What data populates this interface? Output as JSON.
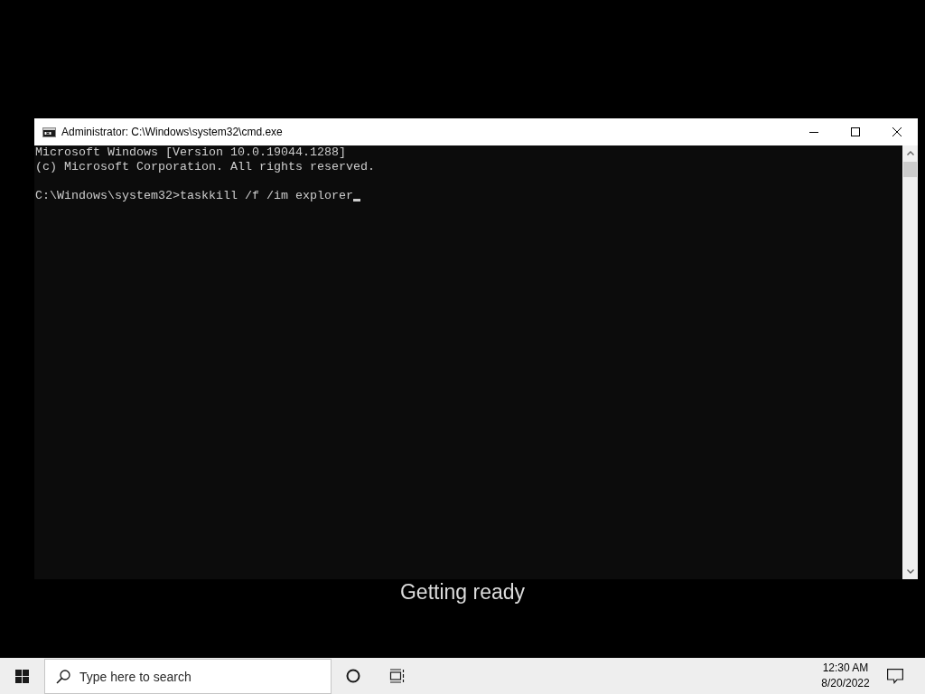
{
  "window": {
    "title": "Administrator: C:\\Windows\\system32\\cmd.exe"
  },
  "console": {
    "output": [
      "Microsoft Windows [Version 10.0.19044.1288]",
      "(c) Microsoft Corporation. All rights reserved."
    ],
    "input_line": "C:\\Windows\\system32>taskkill /f /im explorer",
    "cursor": true
  },
  "desktop": {
    "status_text": "Getting ready"
  },
  "taskbar": {
    "search": {
      "placeholder": "Type here to search"
    },
    "clock": {
      "time": "12:30 AM",
      "date": "8/20/2022"
    }
  }
}
